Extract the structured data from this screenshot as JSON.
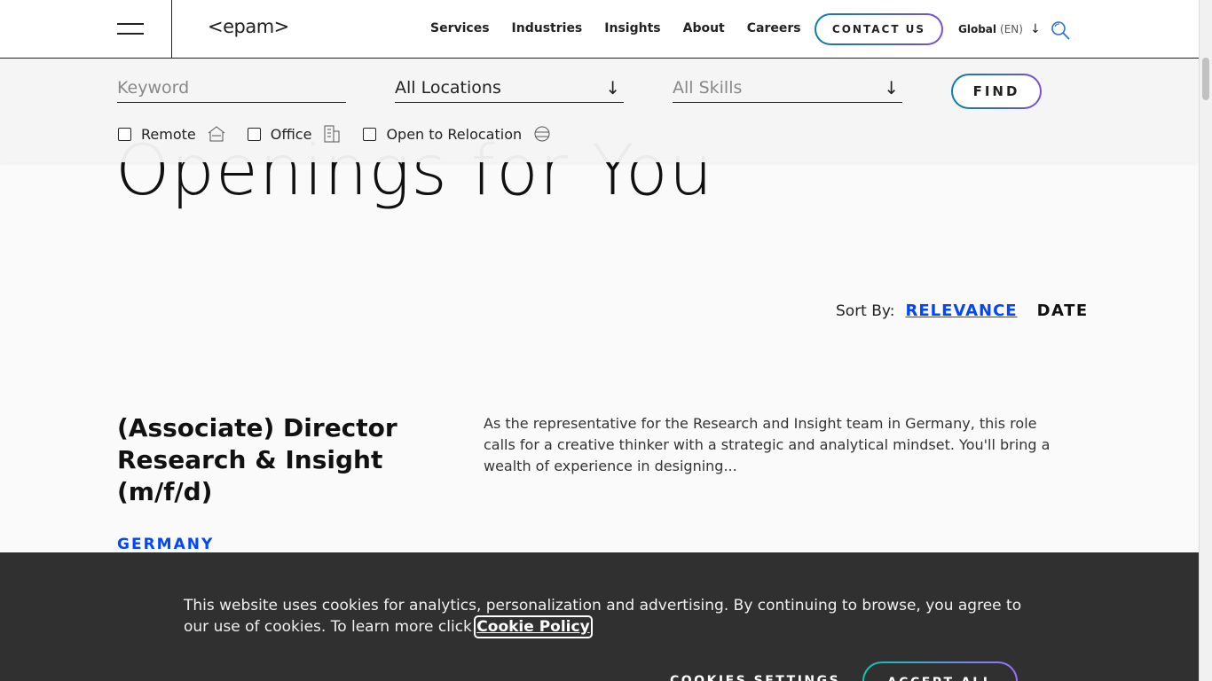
{
  "header": {
    "logo": "<epam>",
    "nav": [
      "Services",
      "Industries",
      "Insights",
      "About",
      "Careers"
    ],
    "contact_label": "CONTACT US",
    "region": "Global",
    "lang": "(EN)"
  },
  "filters": {
    "keyword_placeholder": "Keyword",
    "location_value": "All Locations",
    "skills_placeholder": "All Skills",
    "find_label": "FIND",
    "checkboxes": [
      "Remote",
      "Office",
      "Open to Relocation"
    ]
  },
  "main": {
    "headline": "Openings for You",
    "sort_label": "Sort By:",
    "sort_relevance": "RELEVANCE",
    "sort_date": "DATE"
  },
  "job": {
    "title": "(Associate) Director Research & Insight (m/f/d)",
    "description": "As the representative for the Research and Insight team in Germany, this role calls for a creative thinker with a strategic and analytical mindset. You'll bring a wealth of experience in designing...",
    "country": "GERMANY"
  },
  "cookie": {
    "text": "This website uses cookies for analytics, personalization and advertising. By continuing to browse, you agree to our use of cookies. To learn more click ",
    "link": "Cookie Policy",
    "settings_label": "COOKIES SETTINGS",
    "accept_label": "ACCEPT ALL"
  },
  "colors": {
    "accent_blue": "#0047ff",
    "banner_bg": "#303030"
  }
}
